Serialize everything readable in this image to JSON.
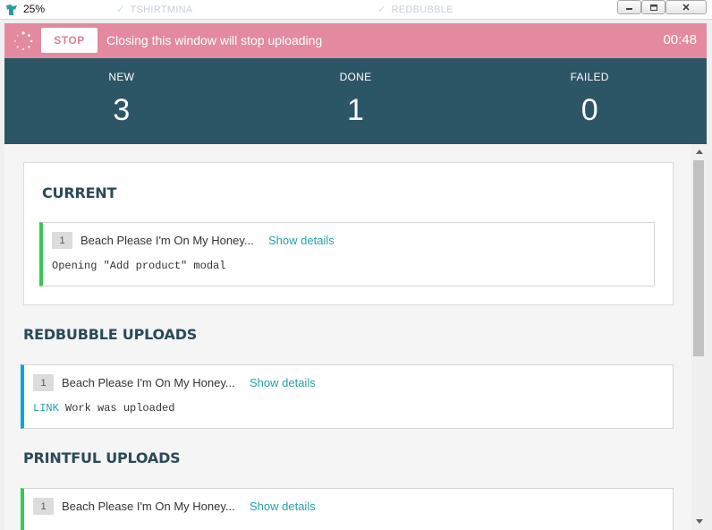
{
  "window": {
    "title": "25%",
    "background_tabs": [
      "TSHIRTMINA",
      "REDBUBBLE"
    ],
    "controls": {
      "minimize": "minimize-icon",
      "maximize": "maximize-icon",
      "close": "close-icon"
    }
  },
  "banner": {
    "stop_label": "STOP",
    "message": "Closing this window will stop uploading",
    "timer": "00:48",
    "color": "#e38aa0"
  },
  "stats": [
    {
      "label": "NEW",
      "value": "3"
    },
    {
      "label": "DONE",
      "value": "1"
    },
    {
      "label": "FAILED",
      "value": "0"
    }
  ],
  "current": {
    "title": "CURRENT",
    "item": {
      "number": "1",
      "title": "Beach Please I'm On My Honey...",
      "details_link": "Show details",
      "log": "Opening \"Add product\" modal"
    }
  },
  "redbubble": {
    "title": "REDBUBBLE UPLOADS",
    "item": {
      "number": "1",
      "title": "Beach Please I'm On My Honey...",
      "details_link": "Show details",
      "log_link": "LINK",
      "log": "Work was uploaded"
    }
  },
  "printful": {
    "title": "PRINTFUL UPLOADS",
    "item": {
      "number": "1",
      "title": "Beach Please I'm On My Honey...",
      "details_link": "Show details"
    }
  },
  "colors": {
    "header_bg": "#2c5566",
    "accent_green": "#37c954",
    "accent_blue": "#0ea2e0",
    "link": "#25a2a6"
  }
}
